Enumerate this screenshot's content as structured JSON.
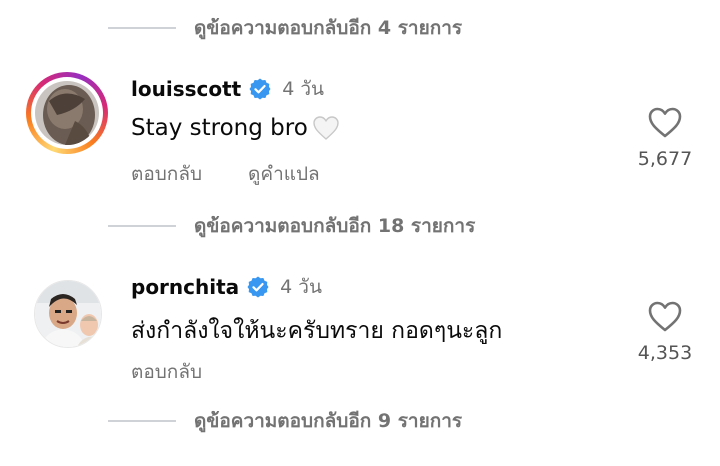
{
  "thread": {
    "view_replies_top": "ดูข้อความตอบกลับอีก 4 รายการ",
    "view_replies_middle": "ดูข้อความตอบกลับอีก 18 รายการ",
    "view_replies_bottom": "ดูข้อความตอบกลับอีก 9 รายการ"
  },
  "comments": [
    {
      "username": "louisscott",
      "verified": true,
      "time": "4 วัน",
      "text": "Stay strong bro",
      "emoji": "white-heart",
      "reply_label": "ตอบกลับ",
      "translate_label": "ดูคำแปล",
      "likes": "5,677",
      "avatar_ring": true
    },
    {
      "username": "pornchita",
      "verified": true,
      "time": "4 วัน",
      "text": "ส่งกำลังใจให้นะครับทราย กอดๆนะลูก",
      "reply_label": "ตอบกลับ",
      "likes": "4,353",
      "avatar_ring": false
    }
  ],
  "icons": {
    "verified_color": "#3897f0",
    "like_icon": "heart-outline-icon",
    "ring_gradient": [
      "#feda75",
      "#fa7e1e",
      "#d62976",
      "#962fbf"
    ]
  }
}
